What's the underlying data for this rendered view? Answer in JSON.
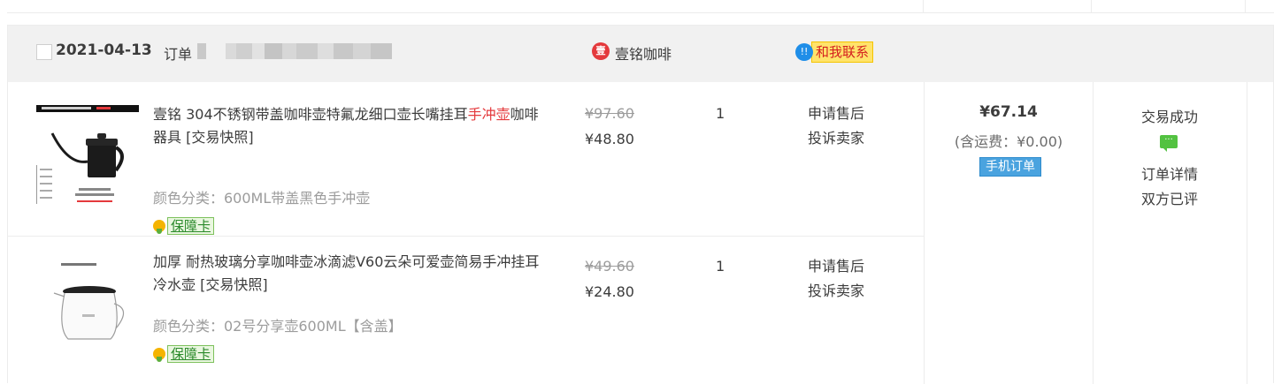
{
  "order": {
    "date": "2021-04-13",
    "order_no_label": "订单",
    "shop_icon": "shop-badge-icon",
    "shop_icon_text": "壹",
    "shop_name": "壹铭咖啡",
    "contact_icon_text": "!!",
    "contact_label": "和我联系",
    "items": [
      {
        "title_main": "壹铭 304不锈钢带盖咖啡壶特氟龙细口壶长嘴挂耳",
        "title_highlight": "手冲壶",
        "title_tail": "咖啡器具 [交易快照]",
        "sku": "颜色分类：600ML带盖黑色手冲壶",
        "guarantee_label": "保障卡",
        "original_price": "¥97.60",
        "price": "¥48.80",
        "quantity": "1",
        "op_after_sale": "申请售后",
        "op_complain": "投诉卖家"
      },
      {
        "title_main": "加厚 耐热玻璃分享咖啡壶冰滴滤V60云朵可爱壶简易手冲挂耳冷水壶 [交易快照]",
        "title_highlight": "",
        "title_tail": "",
        "sku": "颜色分类：02号分享壶600ML【含盖】",
        "guarantee_label": "保障卡",
        "original_price": "¥49.60",
        "price": "¥24.80",
        "quantity": "1",
        "op_after_sale": "申请售后",
        "op_complain": "投诉卖家"
      }
    ],
    "total": "¥67.14",
    "shipping": "(含运费：¥0.00)",
    "mobile_badge": "手机订单",
    "status": "交易成功",
    "order_detail": "订单详情",
    "review_status": "双方已评"
  },
  "colors": {
    "header_bg": "#f1f1f1",
    "highlight_red": "#e4393c",
    "border": "#ececec"
  }
}
